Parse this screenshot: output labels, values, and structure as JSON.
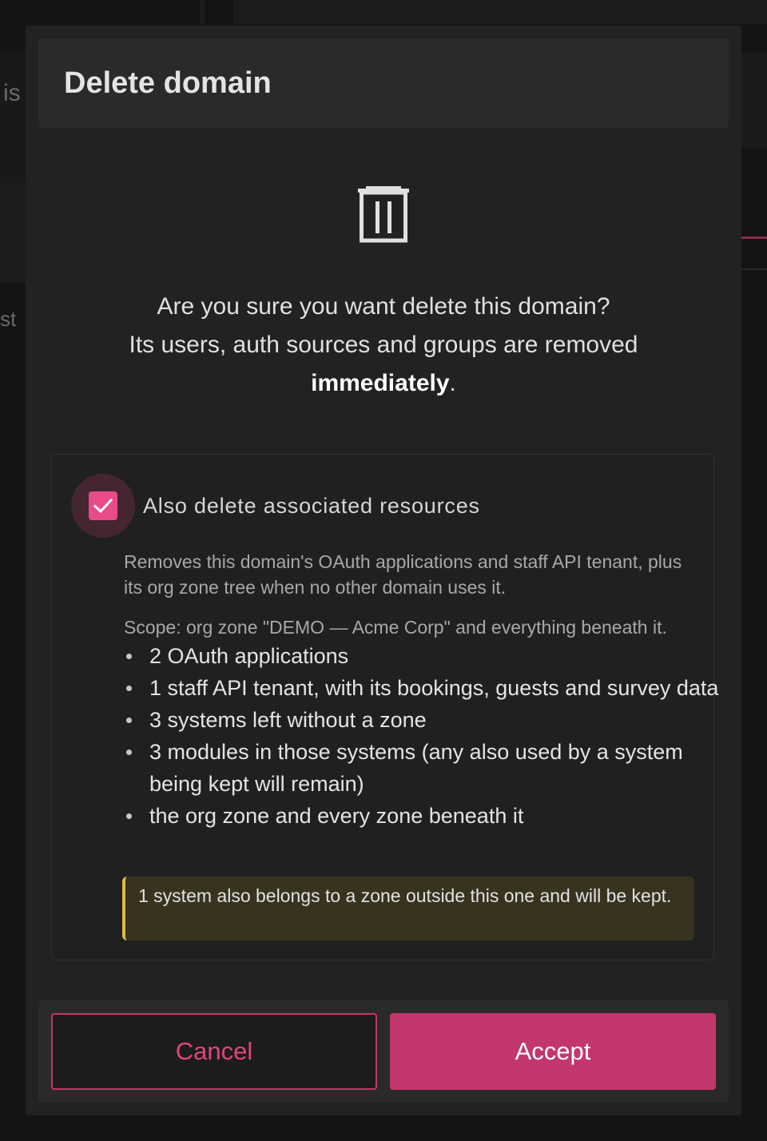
{
  "background": {
    "text_1": "is",
    "text_2": "st"
  },
  "modal": {
    "title": "Delete domain",
    "icon": "trash-icon",
    "message_line1": "Are you sure you want delete this domain?",
    "message_line2": "Its users, auth sources and groups are removed",
    "message_emphasis": "immediately",
    "message_end": "."
  },
  "resources": {
    "checkbox_label": "Also delete associated resources",
    "checkbox_checked": true,
    "hint": "Removes this domain's OAuth applications and staff API tenant, plus its org zone tree when no other domain uses it.",
    "scope": "Scope: org zone \"DEMO — Acme Corp\" and everything beneath it.",
    "items": [
      "2 OAuth applications",
      "1 staff API tenant, with its bookings, guests and survey data",
      "3 systems left without a zone",
      "3 modules in those systems (any also used by a system being kept will remain)",
      "the org zone and every zone beneath it"
    ],
    "warning": "1 system also belongs to a zone outside this one and will be kept."
  },
  "footer": {
    "cancel_label": "Cancel",
    "accept_label": "Accept"
  },
  "colors": {
    "accent": "#c2366e",
    "checkbox": "#e94b8a",
    "warning_border": "#e0b84a",
    "warning_bg": "#38331f"
  }
}
